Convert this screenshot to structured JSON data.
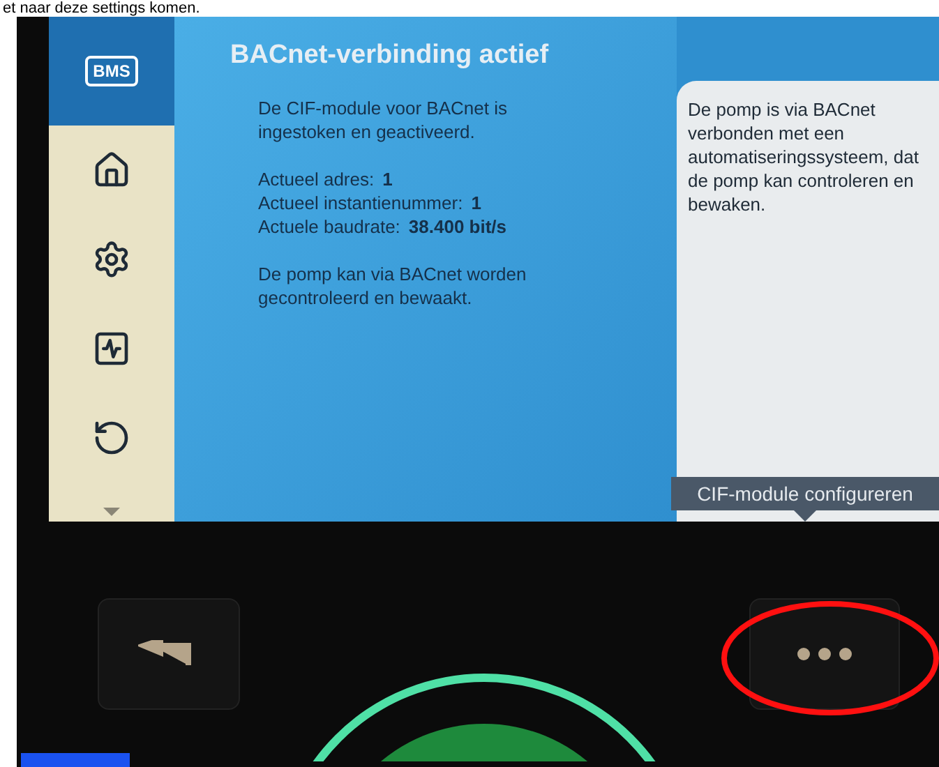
{
  "caption": "et naar deze settings komen.",
  "sidebar": {
    "items": [
      {
        "kind": "label",
        "text": "BMS",
        "selected": true
      },
      {
        "kind": "home",
        "selected": false
      },
      {
        "kind": "settings",
        "selected": false
      },
      {
        "kind": "monitor",
        "selected": false
      },
      {
        "kind": "undo",
        "selected": false
      }
    ]
  },
  "main": {
    "title": "BACnet-verbinding actief",
    "intro": "De CIF-module voor BACnet is ingestoken en geactiveerd.",
    "fields": [
      {
        "label": "Actueel adres:",
        "value": "1"
      },
      {
        "label": "Actueel instantienummer:",
        "value": "1"
      },
      {
        "label": "Actuele baudrate:",
        "value": "38.400 bit/s"
      }
    ],
    "note": "De pomp kan via BACnet worden gecontroleerd en bewaakt."
  },
  "help": {
    "text": "De pomp is via BACnet verbonden met een automatiseringssysteem, dat de pomp kan controleren en bewaken.",
    "tooltip": "CIF-module configureren"
  }
}
